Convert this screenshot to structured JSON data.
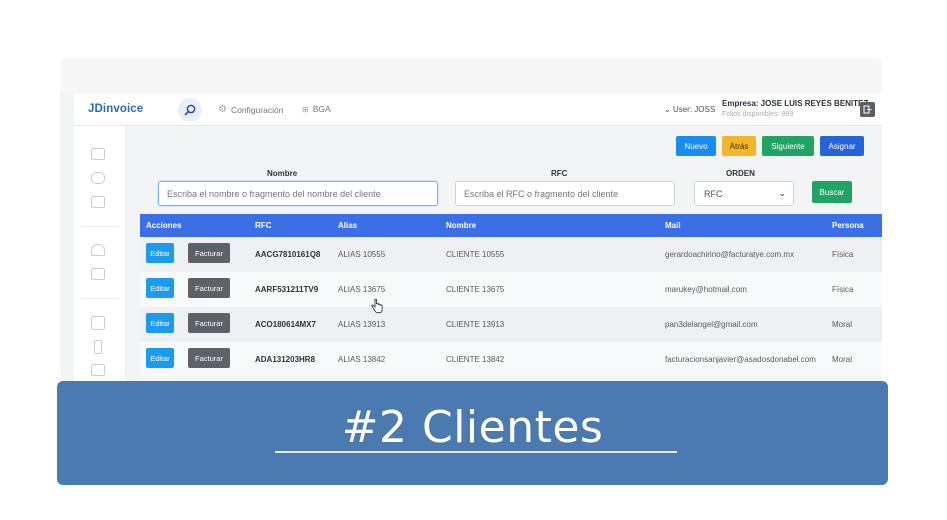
{
  "navbar": {
    "brand": "JDinvoice",
    "config_label": "Configuración",
    "bga_label": "BGA",
    "user_label": "User: JOSS",
    "empresa": "Empresa: JOSE LUIS REYES BENITEZ",
    "folios": "Folios disponibles: 999"
  },
  "toolbar": {
    "nuevo": "Nuevo",
    "atras": "Atrás",
    "siguiente": "Siguiente",
    "asignar": "Asignar"
  },
  "filters": {
    "nombre_label": "Nombre",
    "nombre_placeholder": "Escriba el nombre o fragmento del nombre del cliente",
    "rfc_label": "RFC",
    "rfc_placeholder": "Escriba el RFC o fragmento del cliente",
    "orden_label": "ORDEN",
    "orden_value": "RFC",
    "buscar": "Buscar"
  },
  "table": {
    "headers": [
      "Acciones",
      "RFC",
      "Alias",
      "Nombre",
      "Mail",
      "Persona"
    ],
    "editar": "Editar",
    "facturar": "Facturar",
    "rows": [
      {
        "rfc": "AACG7810161Q8",
        "alias": "ALIAS 10555",
        "nombre": "CLIENTE 10555",
        "mail": "gerardoachirino@facturatye.com.mx",
        "persona": "Física"
      },
      {
        "rfc": "AARF531211TV9",
        "alias": "ALIAS 13675",
        "nombre": "CLIENTE 13675",
        "mail": "marukey@hotmail.com",
        "persona": "Física"
      },
      {
        "rfc": "ACO180614MX7",
        "alias": "ALIAS 13913",
        "nombre": "CLIENTE 13913",
        "mail": "pan3delangel@gmail.com",
        "persona": "Moral"
      },
      {
        "rfc": "ADA131203HR8",
        "alias": "ALIAS 13842",
        "nombre": "CLIENTE 13842",
        "mail": "facturacionsanjavier@asadosdonabel.com",
        "persona": "Moral"
      }
    ]
  },
  "overlay": {
    "title": "#2 Clientes"
  },
  "colors": {
    "accent_blue": "#3b6fe6",
    "overlay_blue": "#4a7aaf",
    "green": "#1fa463",
    "amber": "#f5b52a"
  }
}
